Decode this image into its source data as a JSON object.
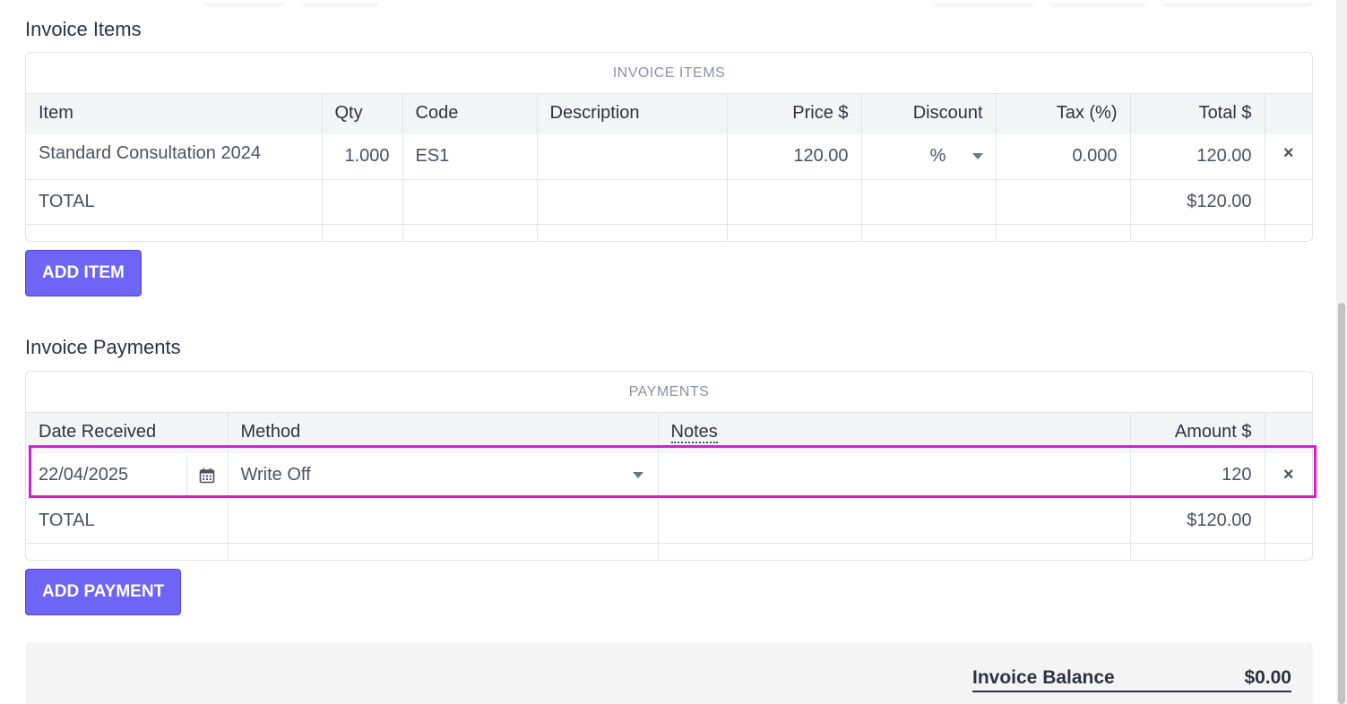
{
  "items_section": {
    "title": "Invoice Items",
    "caption": "INVOICE ITEMS",
    "columns": [
      "Item",
      "Qty",
      "Code",
      "Description",
      "Price $",
      "Discount",
      "Tax (%)",
      "Total $"
    ],
    "rows": [
      {
        "item": "Standard Consultation 2024",
        "qty": "1.000",
        "code": "ES1",
        "description": "",
        "price": "120.00",
        "discount_type": "%",
        "tax": "0.000",
        "total": "120.00",
        "remove": "×"
      }
    ],
    "total_label": "TOTAL",
    "total_value": "$120.00",
    "add_button": "ADD ITEM"
  },
  "payments_section": {
    "title": "Invoice Payments",
    "caption": "PAYMENTS",
    "columns": [
      "Date Received",
      "Method",
      "Notes",
      "Amount $"
    ],
    "rows": [
      {
        "date": "22/04/2025",
        "method": "Write Off",
        "notes": "",
        "amount": "120",
        "remove": "×"
      }
    ],
    "total_label": "TOTAL",
    "total_value": "$120.00",
    "add_button": "ADD PAYMENT"
  },
  "balance": {
    "label": "Invoice Balance",
    "value": "$0.00"
  },
  "icons": {
    "calendar": "calendar-icon",
    "dropdown": "chevron-down-icon",
    "remove": "close-icon"
  },
  "colors": {
    "primary_button": "#6e64f5",
    "remove_icon": "#c4144e",
    "highlight": "#d41ed6"
  }
}
